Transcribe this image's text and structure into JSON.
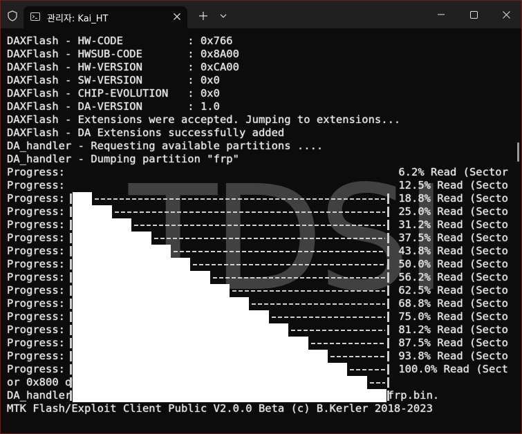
{
  "window": {
    "tab_title": "관리자: Kai_HT",
    "tab_icon": "terminal-icon",
    "new_tab_icon": "plus-icon",
    "dropdown_icon": "chevron-down-icon",
    "minimize_icon": "minimize-icon",
    "maximize_icon": "maximize-icon",
    "close_icon": "close-icon",
    "accent_border": "#6a2020"
  },
  "terminal": {
    "header_lines": [
      "DAXFlash - HW-CODE          : 0x766",
      "DAXFlash - HWSUB-CODE       : 0x8A00",
      "DAXFlash - HW-VERSION       : 0xCA00",
      "DAXFlash - SW-VERSION       : 0x0",
      "DAXFlash - CHIP-EVOLUTION   : 0x0",
      "DAXFlash - DA-VERSION       : 1.0",
      "DAXFlash - Extensions were accepted. Jumping to extensions...",
      "DAXFlash - DA Extensions successfully added",
      "DA_handler - Requesting available partitions ....",
      "DA_handler - Dumping partition \"frp\""
    ],
    "progress_label": "Progress: ",
    "progress_rows": [
      {
        "percent_text": "6.2%",
        "suffix": " Read (Sector",
        "fraction": 0.0625
      },
      {
        "percent_text": "12.5%",
        "suffix": " Read (Secto",
        "fraction": 0.125
      },
      {
        "percent_text": "18.8%",
        "suffix": " Read (Secto",
        "fraction": 0.1875
      },
      {
        "percent_text": "25.0%",
        "suffix": " Read (Secto",
        "fraction": 0.25
      },
      {
        "percent_text": "31.2%",
        "suffix": " Read (Secto",
        "fraction": 0.3125
      },
      {
        "percent_text": "37.5%",
        "suffix": " Read (Secto",
        "fraction": 0.375
      },
      {
        "percent_text": "43.8%",
        "suffix": " Read (Secto",
        "fraction": 0.4375
      },
      {
        "percent_text": "50.0%",
        "suffix": " Read (Secto",
        "fraction": 0.5
      },
      {
        "percent_text": "56.2%",
        "suffix": " Read (Secto",
        "fraction": 0.5625
      },
      {
        "percent_text": "62.5%",
        "suffix": " Read (Secto",
        "fraction": 0.625
      },
      {
        "percent_text": "68.8%",
        "suffix": " Read (Secto",
        "fraction": 0.6875
      },
      {
        "percent_text": "75.0%",
        "suffix": " Read (Secto",
        "fraction": 0.75
      },
      {
        "percent_text": "81.2%",
        "suffix": " Read (Secto",
        "fraction": 0.8125
      },
      {
        "percent_text": "87.5%",
        "suffix": " Read (Secto",
        "fraction": 0.875
      },
      {
        "percent_text": "93.8%",
        "suffix": " Read (Secto",
        "fraction": 0.9375
      },
      {
        "percent_text": "100.0%",
        "suffix": " Read (Sect",
        "fraction": 1.0
      }
    ],
    "footer_lines": [
      "or 0x800 of 0x800, ) 3.64 MB/s",
      "DA_handler - Dumped sector 44096 with sector count 2048 as frp.bin.",
      "MTK Flash/Exploit Client Public V2.0.0 Beta (c) B.Kerler 2018-2023"
    ],
    "watermark_text": "TDSI",
    "text_color": "#e6e6e6",
    "background": "#0c0c0c"
  }
}
